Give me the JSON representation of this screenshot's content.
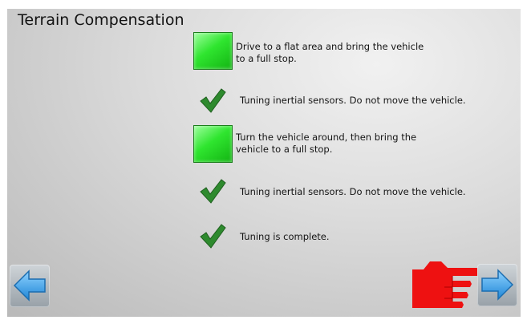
{
  "title": "Terrain Compensation",
  "steps": [
    {
      "kind": "action",
      "lines": [
        "Drive to a flat area and bring the vehicle",
        "to a full stop."
      ]
    },
    {
      "kind": "done",
      "lines": [
        "Tuning inertial sensors. Do not move the vehicle."
      ]
    },
    {
      "kind": "action",
      "lines": [
        "Turn the vehicle around, then bring the",
        "vehicle to a full stop."
      ]
    },
    {
      "kind": "done",
      "lines": [
        "Tuning inertial sensors. Do not move the vehicle."
      ]
    },
    {
      "kind": "done",
      "lines": [
        "Tuning is complete."
      ]
    }
  ],
  "nav": {
    "back": "arrow-left-icon",
    "next": "arrow-right-icon",
    "pointer": "pointing-hand-icon"
  },
  "colors": {
    "green": "#2fe52f",
    "check": "#2e8a2e",
    "arrow": "#3aa0e8",
    "hand": "#ee1111"
  }
}
